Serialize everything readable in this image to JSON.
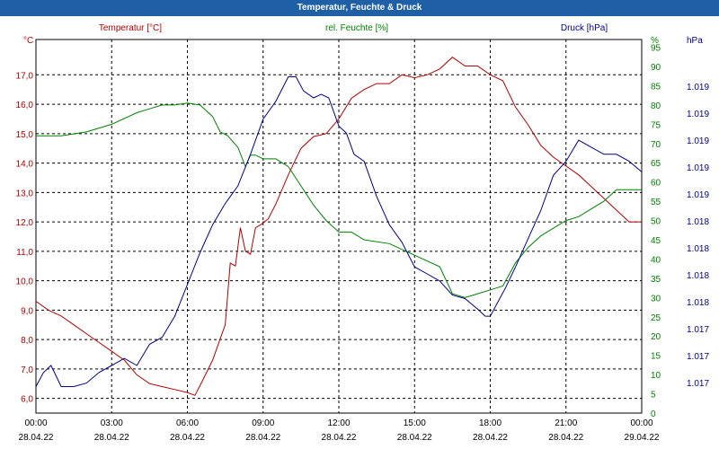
{
  "title": "Temperatur, Feuchte & Druck",
  "colors": {
    "titlebar": "#1f5fa6",
    "temp": "#b00000",
    "hum": "#008000",
    "press": "#00008b"
  },
  "chart_data": {
    "type": "line",
    "grid": true,
    "x_ticks": [
      {
        "time": "00:00",
        "date": "28.04.22"
      },
      {
        "time": "03:00",
        "date": "28.04.22"
      },
      {
        "time": "06:00",
        "date": "28.04.22"
      },
      {
        "time": "09:00",
        "date": "28.04.22"
      },
      {
        "time": "12:00",
        "date": "28.04.22"
      },
      {
        "time": "15:00",
        "date": "28.04.22"
      },
      {
        "time": "18:00",
        "date": "28.04.22"
      },
      {
        "time": "21:00",
        "date": "28.04.22"
      },
      {
        "time": "00:00",
        "date": "29.04.22"
      }
    ],
    "x_range_hours": [
      0,
      24
    ],
    "axes": {
      "temp": {
        "unit_label": "°C",
        "title": "Temperatur [°C]",
        "range": [
          5.5,
          18.2
        ],
        "ticks": [
          "6,0",
          "7,0",
          "8,0",
          "9,0",
          "10,0",
          "11,0",
          "12,0",
          "13,0",
          "14,0",
          "15,0",
          "16,0",
          "17,0"
        ]
      },
      "hum": {
        "unit_label": "%",
        "title": "rel. Feuchte [%]",
        "range": [
          0,
          97
        ],
        "ticks": [
          "0",
          "5",
          "10",
          "15",
          "20",
          "25",
          "30",
          "35",
          "40",
          "45",
          "50",
          "55",
          "60",
          "65",
          "70",
          "75",
          "80",
          "85",
          "90",
          "95"
        ]
      },
      "press": {
        "unit_label": "hPa",
        "title": "Druck [hPa]",
        "ticks": [
          "1.017",
          "1.017",
          "1.017",
          "1.018",
          "1.018",
          "1.018",
          "1.018",
          "1.019",
          "1.019",
          "1.019",
          "1.019",
          "1.019"
        ]
      }
    },
    "series": [
      {
        "name": "Temperatur [°C]",
        "axis": "temp",
        "x": [
          0,
          0.5,
          1,
          1.5,
          2,
          2.5,
          3,
          3.5,
          4,
          4.5,
          5,
          5.5,
          6,
          6.3,
          6.6,
          7,
          7.5,
          7.7,
          7.9,
          8.1,
          8.3,
          8.5,
          8.7,
          8.9,
          9.2,
          9.5,
          10,
          10.5,
          11,
          11.5,
          12,
          12.5,
          13,
          13.5,
          14,
          14.5,
          15,
          15.5,
          16,
          16.5,
          17,
          17.5,
          18,
          18.5,
          19,
          19.5,
          20,
          20.5,
          21,
          21.5,
          22,
          22.5,
          23,
          23.5,
          24
        ],
        "values": [
          9.3,
          9.0,
          8.8,
          8.5,
          8.2,
          7.9,
          7.6,
          7.3,
          6.8,
          6.5,
          6.4,
          6.3,
          6.2,
          6.1,
          6.6,
          7.3,
          8.5,
          10.6,
          10.5,
          11.8,
          11.0,
          10.9,
          11.8,
          11.9,
          12.1,
          12.6,
          13.6,
          14.5,
          14.9,
          15.0,
          15.5,
          16.2,
          16.5,
          16.7,
          16.7,
          17.0,
          16.9,
          17.0,
          17.2,
          17.6,
          17.3,
          17.3,
          17.0,
          16.8,
          15.9,
          15.3,
          14.6,
          14.2,
          13.9,
          13.6,
          13.2,
          12.8,
          12.4,
          12.0,
          12.0
        ]
      },
      {
        "name": "rel. Feuchte [%]",
        "axis": "hum",
        "x": [
          0,
          1,
          2,
          3,
          4,
          4.5,
          5,
          5.5,
          6,
          6.5,
          7,
          7.3,
          7.6,
          8,
          8.3,
          8.5,
          8.7,
          9,
          9.5,
          10,
          10.5,
          11,
          11.5,
          12,
          12.5,
          13,
          14,
          15,
          16,
          16.5,
          17,
          17.5,
          18,
          18.5,
          19,
          19.5,
          20,
          20.5,
          21,
          21.5,
          22,
          22.5,
          23,
          23.5,
          24
        ],
        "values": [
          72,
          72,
          73,
          75,
          78,
          79,
          80,
          80,
          80.5,
          80,
          77,
          73,
          72,
          69,
          64,
          67,
          67,
          66,
          66,
          64,
          59,
          54,
          50,
          47,
          47,
          45,
          44,
          41,
          38,
          31,
          30,
          31,
          32,
          33,
          39,
          43,
          46,
          48,
          50,
          51,
          53,
          55,
          58,
          58,
          58
        ]
      },
      {
        "name": "Druck [hPa]",
        "axis": "press",
        "x": [
          0,
          0.3,
          0.6,
          1,
          1.5,
          2,
          2.5,
          3,
          3.5,
          4,
          4.5,
          5,
          5.5,
          6,
          6.5,
          7,
          7.5,
          8,
          8.5,
          9,
          9.5,
          10,
          10.3,
          10.6,
          11,
          11.3,
          11.6,
          12,
          12.3,
          12.6,
          13,
          13.5,
          14,
          14.5,
          15,
          15.5,
          16,
          16.5,
          17,
          17.5,
          17.8,
          18,
          18.3,
          18.6,
          19,
          19.5,
          20,
          20.5,
          21,
          21.5,
          22,
          22.5,
          23,
          23.5,
          24
        ],
        "values": [
          6,
          10,
          12,
          6,
          6,
          7,
          10,
          12,
          14,
          12,
          18,
          20,
          26,
          35,
          44,
          52,
          58,
          63,
          72,
          82,
          87,
          94,
          94,
          90,
          88,
          89,
          88,
          80,
          78,
          72,
          70,
          60,
          52,
          47,
          40,
          38,
          36,
          32,
          31,
          28,
          26,
          26,
          30,
          34,
          40,
          48,
          56,
          66,
          70,
          76,
          74,
          72,
          72,
          70,
          67
        ]
      }
    ]
  }
}
